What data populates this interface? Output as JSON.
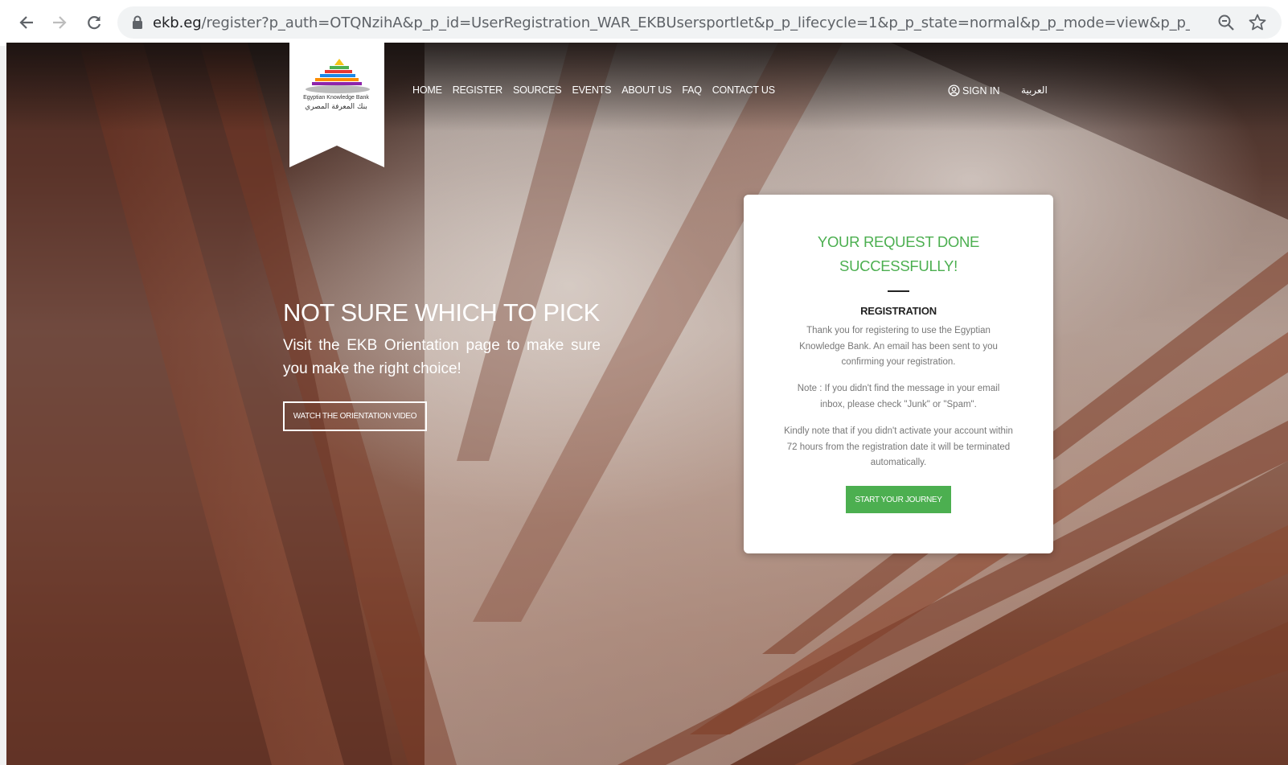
{
  "browser": {
    "url_host": "ekb.eg",
    "url_path": "/register?p_auth=OTQNzihA&p_p_id=UserRegistration_WAR_EKBUsersportlet&p_p_lifecycle=1&p_p_state=normal&p_p_mode=view&p_p_col_id=colu...",
    "back_icon": "arrow-left-icon",
    "forward_icon": "arrow-right-icon",
    "reload_icon": "reload-icon"
  },
  "logo": {
    "name_en": "Egyptian Knowledge Bank",
    "name_ar": "بنك المعرفة المصري"
  },
  "nav": {
    "items": [
      "HOME",
      "REGISTER",
      "SOURCES",
      "EVENTS",
      "ABOUT US",
      "FAQ",
      "CONTACT US"
    ],
    "sign_in": "SIGN IN",
    "language": "العربية"
  },
  "hero": {
    "title": "NOT SURE WHICH TO PICK",
    "subtitle": "Visit the EKB Orientation page to make sure you make the right choice!",
    "button": "WATCH THE ORIENTATION VIDEO"
  },
  "card": {
    "title_line1": "YOUR REQUEST DONE",
    "title_line2": "SUCCESSFULLY!",
    "heading": "REGISTRATION",
    "paragraph1": "Thank you for registering to use the Egyptian Knowledge Bank. An email has been sent to you confirming your registration.",
    "paragraph2": "Note : If you didn't find the message in your email inbox, please check \"Junk\" or \"Spam\".",
    "paragraph3": "Kindly note that if you didn't activate your account within 72 hours from the registration date it will be terminated automatically.",
    "button": "START YOUR JOURNEY"
  },
  "colors": {
    "accent_green": "#4caf50",
    "card_text": "#777777"
  }
}
